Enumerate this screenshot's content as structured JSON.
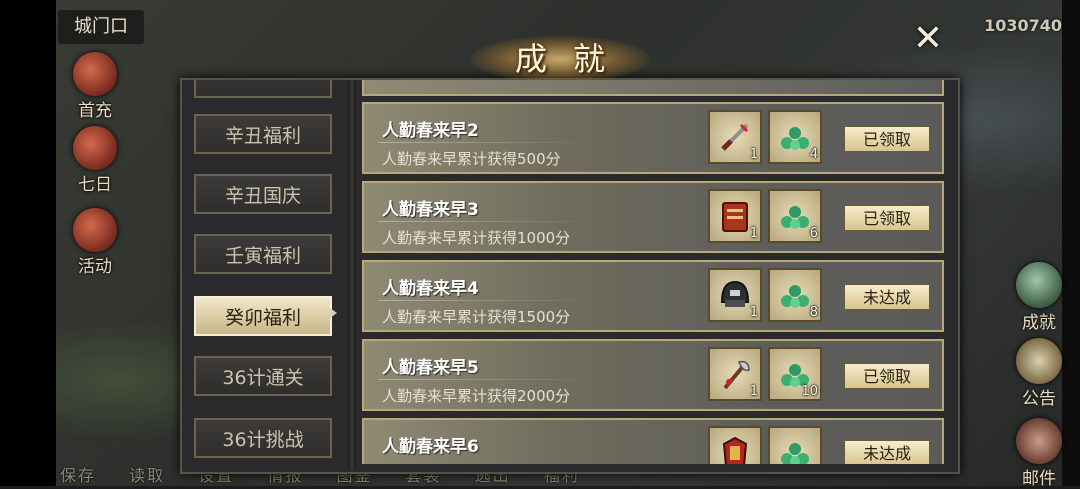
{
  "hud": {
    "location": "城门口",
    "gold": "1030740",
    "left_menu": [
      {
        "label": "首充"
      },
      {
        "label": "七日"
      },
      {
        "label": "活动"
      }
    ],
    "right_menu": [
      {
        "label": "成就"
      },
      {
        "label": "公告"
      },
      {
        "label": "邮件"
      }
    ],
    "bottom_bar": [
      "保存",
      "读取",
      "设置",
      "情报",
      "图鉴",
      "套装",
      "逃出",
      "福利"
    ]
  },
  "dialog": {
    "title": "成就",
    "close_icon": "close-icon",
    "tabs": [
      {
        "label": ""
      },
      {
        "label": "辛丑福利"
      },
      {
        "label": "辛丑国庆"
      },
      {
        "label": "壬寅福利"
      },
      {
        "label": "癸卯福利",
        "active": true
      },
      {
        "label": "36计通关"
      },
      {
        "label": "36计挑战"
      }
    ],
    "achievements": [
      {
        "name": "人勤春来早2",
        "desc": "人勤春来早累计获得500分",
        "rewards": [
          {
            "icon": "sword-icon",
            "count": "1"
          },
          {
            "icon": "jade-gem-icon",
            "count": "4"
          }
        ],
        "button": "已领取"
      },
      {
        "name": "人勤春来早3",
        "desc": "人勤春来早累计获得1000分",
        "rewards": [
          {
            "icon": "book-icon",
            "count": "1"
          },
          {
            "icon": "jade-gem-icon",
            "count": "6"
          }
        ],
        "button": "已领取"
      },
      {
        "name": "人勤春来早4",
        "desc": "人勤春来早累计获得1500分",
        "rewards": [
          {
            "icon": "helmet-icon",
            "count": "1"
          },
          {
            "icon": "jade-gem-icon",
            "count": "8"
          }
        ],
        "button": "未达成"
      },
      {
        "name": "人勤春来早5",
        "desc": "人勤春来早累计获得2000分",
        "rewards": [
          {
            "icon": "axe-icon",
            "count": "1"
          },
          {
            "icon": "jade-gem-icon",
            "count": "10"
          }
        ],
        "button": "已领取"
      },
      {
        "name": "人勤春来早6",
        "desc": "",
        "rewards": [
          {
            "icon": "armor-icon",
            "count": ""
          },
          {
            "icon": "jade-gem-icon",
            "count": ""
          }
        ],
        "button": "未达成"
      }
    ]
  }
}
